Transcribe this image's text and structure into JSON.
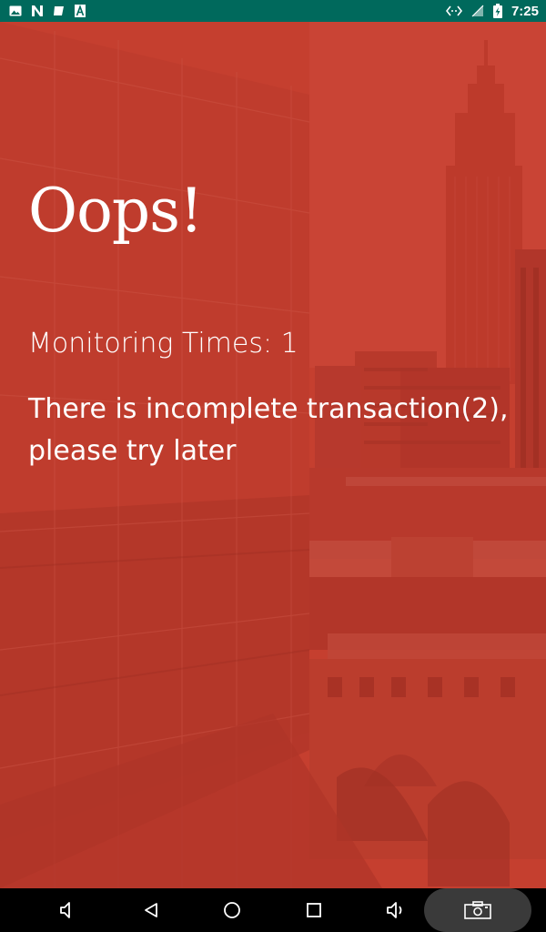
{
  "status_bar": {
    "time": "7:25",
    "left_icons": [
      "image-icon",
      "n-app-icon",
      "notes-icon",
      "font-icon"
    ],
    "right_icons": [
      "data-transfer-icon",
      "signal-icon",
      "battery-charging-icon"
    ],
    "bg_color": "#00695c"
  },
  "main": {
    "title": "Oops!",
    "monitoring_text": "Monitoring Times: 1",
    "message": "There is incomplete transaction(2), please try later",
    "overlay_color": "#c43a2c"
  },
  "nav_bar": {
    "buttons": [
      "volume-down-icon",
      "back-icon",
      "home-icon",
      "recents-icon",
      "volume-up-icon",
      "screenshot-icon"
    ]
  }
}
